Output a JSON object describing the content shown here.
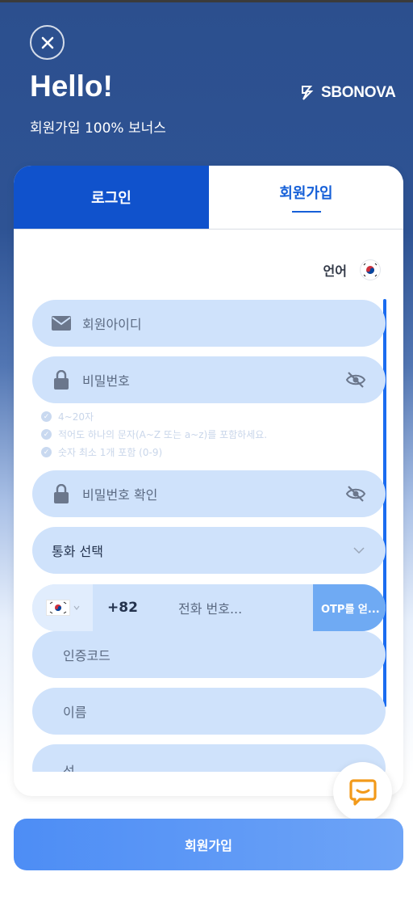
{
  "header": {
    "title": "Hello!",
    "subtitle": "회원가입 100% 보너스",
    "brand": "SBONOVA"
  },
  "tabs": {
    "login": "로그인",
    "signup": "회원가입"
  },
  "language": {
    "label": "언어",
    "flag": "kr-flag-icon"
  },
  "form": {
    "username_placeholder": "회원아이디",
    "password_placeholder": "비밀번호",
    "hints": [
      "4~20자",
      "적어도 하나의 문자(A~Z 또는 a~z)를 포함하세요.",
      "숫자 최소 1개 포함 (0-9)"
    ],
    "password_confirm_placeholder": "비밀번호 확인",
    "currency_placeholder": "통화 선택",
    "phone_code": "+82",
    "phone_placeholder": "전화 번호...",
    "otp_button": "OTP를 얻...",
    "auth_code_placeholder": "인증코드",
    "first_name_placeholder": "이름",
    "last_name_placeholder": "성"
  },
  "submit_label": "회원가입",
  "colors": {
    "primary": "#1052cc",
    "field_bg": "#cfe2fb",
    "accent": "#1660d8",
    "chat_icon": "#f29a1a"
  }
}
